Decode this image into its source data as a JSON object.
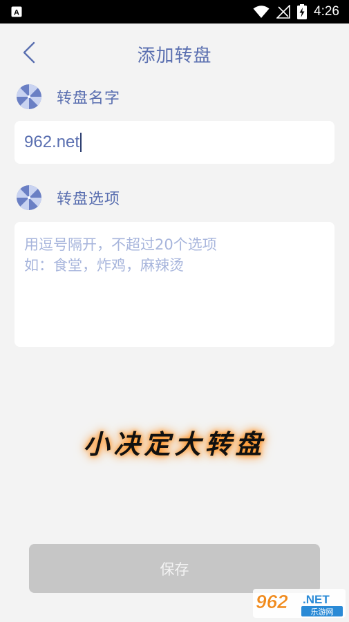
{
  "status_bar": {
    "time": "4:26",
    "icons": [
      "app-notification-icon",
      "wifi-icon",
      "signal-icon",
      "battery-charging-icon"
    ]
  },
  "header": {
    "title": "添加转盘",
    "back_icon": "chevron-left-icon"
  },
  "name_section": {
    "label": "转盘名字",
    "icon": "wheel-icon",
    "input_value": "962.net"
  },
  "options_section": {
    "label": "转盘选项",
    "icon": "wheel-icon",
    "placeholder_line1": "用逗号隔开，不超过20个选项",
    "placeholder_line2": "如：食堂，炸鸡，麻辣烫"
  },
  "brand": {
    "text": "小决定大转盘"
  },
  "save_button": {
    "label": "保存"
  },
  "watermark": {
    "logo": "962",
    "domain": ".NET",
    "subtitle": "乐游网"
  },
  "colors": {
    "accent": "#5a6fb0",
    "placeholder": "#a7b5dc",
    "background": "#f3f3f3",
    "button_disabled": "#c6c6c6",
    "glow": "#ff9a2e"
  }
}
